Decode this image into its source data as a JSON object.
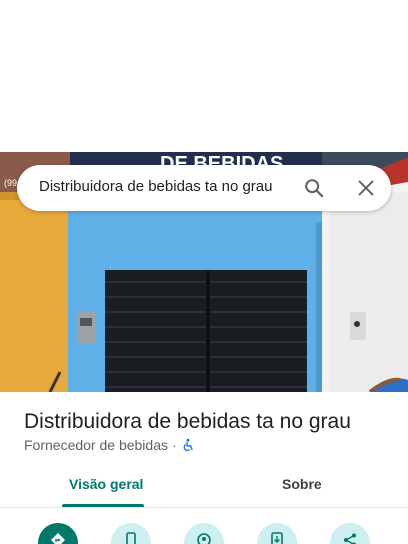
{
  "search": {
    "query": "Distribuidora de bebidas ta no grau"
  },
  "photo": {
    "sign_text": "DE BEBIDAS",
    "phone_fragment": "(99"
  },
  "place": {
    "title": "Distribuidora de bebidas ta no grau",
    "category": "Fornecedor de bebidas",
    "separator": "·",
    "accessibility_icon": "wheelchair-icon"
  },
  "tabs": [
    {
      "label": "Visão geral",
      "active": true
    },
    {
      "label": "Sobre",
      "active": false
    }
  ],
  "actions": [
    {
      "icon": "directions-icon"
    },
    {
      "icon": "phone-icon"
    },
    {
      "icon": "nearby-icon"
    },
    {
      "icon": "send-to-phone-icon"
    },
    {
      "icon": "share-icon"
    }
  ],
  "colors": {
    "accent": "#00796b",
    "wall_blue": "#5fb0e6",
    "action_bg": "#cdeff0"
  }
}
